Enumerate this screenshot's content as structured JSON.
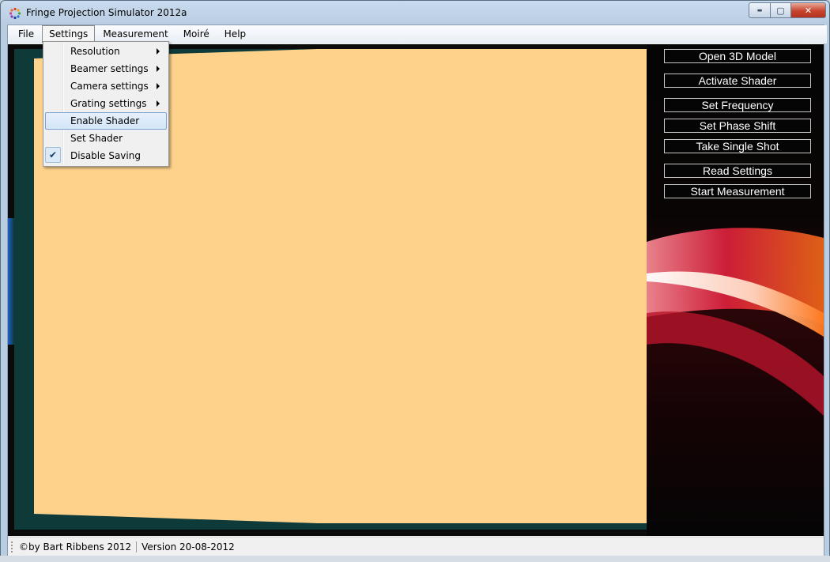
{
  "window": {
    "title": "Fringe Projection Simulator 2012a",
    "caption": {
      "minimize": "▬",
      "maximize": "▢",
      "close": "✕"
    }
  },
  "menubar": {
    "items": [
      "File",
      "Settings",
      "Measurement",
      "Moiré",
      "Help"
    ],
    "open_item": "Settings"
  },
  "settings_menu": {
    "items": [
      {
        "label": "Resolution",
        "submenu": true
      },
      {
        "label": "Beamer settings",
        "submenu": true
      },
      {
        "label": "Camera settings",
        "submenu": true
      },
      {
        "label": "Grating settings",
        "submenu": true
      },
      {
        "label": "Enable Shader",
        "highlighted": true
      },
      {
        "label": "Set Shader"
      },
      {
        "label": "Disable Saving",
        "checked": true
      }
    ],
    "check_glyph": "✔"
  },
  "actions": {
    "open_3d_model": "Open 3D Model",
    "activate_shader": "Activate Shader",
    "set_frequency": "Set Frequency",
    "set_phase_shift": "Set Phase Shift",
    "take_single_shot": "Take Single Shot",
    "read_settings": "Read Settings",
    "start_measurement": "Start Measurement"
  },
  "statusbar": {
    "author": "©by Bart Ribbens 2012",
    "version": "Version 20-08-2012"
  },
  "colors": {
    "projection_surface": "#fed28b",
    "scene_background": "#0e3a3a",
    "panel_background": "#050505",
    "accent_red": "#d81e3a",
    "accent_orange": "#f05a1a",
    "menu_highlight": "#d3e5f8"
  }
}
